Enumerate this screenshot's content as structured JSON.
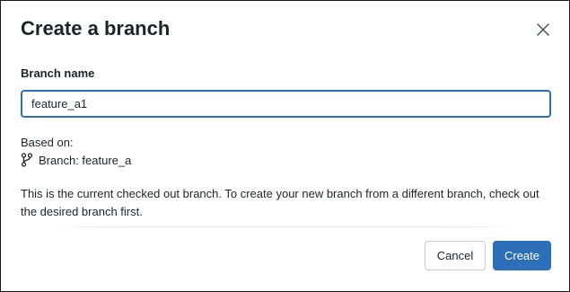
{
  "dialog": {
    "title": "Create a branch",
    "close_icon": "close-icon"
  },
  "form": {
    "branch_name_label": "Branch name",
    "branch_name_value": "feature_a1",
    "based_on_label": "Based on:",
    "source_branch_icon": "git-branch-icon",
    "source_branch_text": "Branch: feature_a",
    "description": "This is the current checked out branch. To create your new branch from a different branch, check out the desired branch first."
  },
  "actions": {
    "cancel_label": "Cancel",
    "create_label": "Create"
  },
  "colors": {
    "primary": "#2c6fb7",
    "focus_border": "#2c6fbb",
    "text": "#1f2328"
  }
}
